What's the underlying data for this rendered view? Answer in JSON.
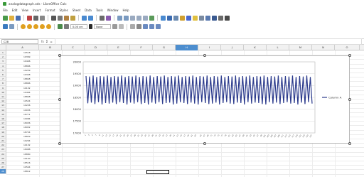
{
  "window": {
    "title": "analogdatagraph.ods - LibreOffice Calc"
  },
  "menu": [
    "File",
    "Edit",
    "View",
    "Insert",
    "Format",
    "Styles",
    "Sheet",
    "Data",
    "Tools",
    "Window",
    "Help"
  ],
  "toolbar": {
    "line_width": "0.00 cm",
    "line_style": "None"
  },
  "formula_bar": {
    "name_box": "C28",
    "fx": "fx",
    "sum": "Σ",
    "equals": "=",
    "value": ""
  },
  "columns": [
    "A",
    "B",
    "C",
    "D",
    "E",
    "F",
    "G",
    "H",
    "I",
    "J",
    "K",
    "L",
    "M",
    "N",
    "O"
  ],
  "selected_column": "H",
  "selected_row": 28,
  "rows": [
    {
      "n": 1,
      "v": "19518"
    },
    {
      "n": 2,
      "v": "19369"
    },
    {
      "n": 3,
      "v": "19446"
    },
    {
      "n": 4,
      "v": "18896"
    },
    {
      "n": 5,
      "v": "19229"
    },
    {
      "n": 6,
      "v": "19348"
    },
    {
      "n": 7,
      "v": "18848"
    },
    {
      "n": 8,
      "v": "18896"
    },
    {
      "n": 9,
      "v": "19132"
    },
    {
      "n": 10,
      "v": "19464"
    },
    {
      "n": 11,
      "v": "18848"
    },
    {
      "n": 12,
      "v": "19524"
    },
    {
      "n": 13,
      "v": "19226"
    },
    {
      "n": 14,
      "v": "19036"
    },
    {
      "n": 15,
      "v": "18771"
    },
    {
      "n": 16,
      "v": "19084"
    },
    {
      "n": 17,
      "v": "18936"
    },
    {
      "n": 18,
      "v": "18952"
    },
    {
      "n": 19,
      "v": "18724"
    },
    {
      "n": 20,
      "v": "18829"
    },
    {
      "n": 21,
      "v": "19294"
    },
    {
      "n": 22,
      "v": "19132"
    },
    {
      "n": 23,
      "v": "18988"
    },
    {
      "n": 24,
      "v": "18880"
    },
    {
      "n": 25,
      "v": "19140"
    },
    {
      "n": 26,
      "v": "18516"
    },
    {
      "n": 27,
      "v": "19544"
    },
    {
      "n": 28,
      "v": "18812"
    }
  ],
  "chart": {
    "y_ticks": [
      "20000",
      "19500",
      "19000",
      "18500",
      "18000",
      "17500",
      "17000"
    ],
    "legend": "Column A",
    "line_color": "#2b3a8c",
    "series": [
      19400,
      18250,
      19380,
      18280,
      19420,
      18220,
      19360,
      18300,
      19400,
      18200,
      19380,
      18260,
      19420,
      18240,
      19360,
      18280,
      19400,
      18220,
      19380,
      18300,
      19420,
      18260,
      19360,
      18200,
      19400,
      18280,
      19380,
      18240,
      19420,
      18300,
      19360,
      18220,
      19400,
      18260,
      19380,
      18200,
      19420,
      18280,
      19360,
      18240,
      19400,
      18300,
      19380,
      18220,
      19420,
      18260,
      19360,
      18280,
      19400,
      18200,
      19380,
      18240,
      19420,
      18300,
      19360,
      18260,
      19400,
      18220,
      19380,
      18280,
      19420,
      18240,
      19360,
      18200,
      19400,
      18300,
      19380,
      18260,
      19420,
      18220,
      19360,
      18240,
      19400,
      18280,
      19380,
      18200,
      19420,
      18260,
      19360,
      18300,
      19400,
      18240,
      19380,
      18220,
      19420,
      18280,
      19360,
      18260,
      19400,
      18200,
      19380,
      18300,
      19420,
      18240,
      19360,
      18280,
      19400,
      18260,
      19380,
      18220,
      19420,
      18200,
      19360,
      18300,
      19400,
      18240,
      19380,
      18280,
      19420,
      18220,
      19360,
      18260,
      19400,
      18300,
      19380,
      18240,
      19420,
      18260,
      19360,
      18200,
      19400,
      18280,
      19380,
      18220,
      19420,
      18300,
      19360,
      18240
    ]
  }
}
